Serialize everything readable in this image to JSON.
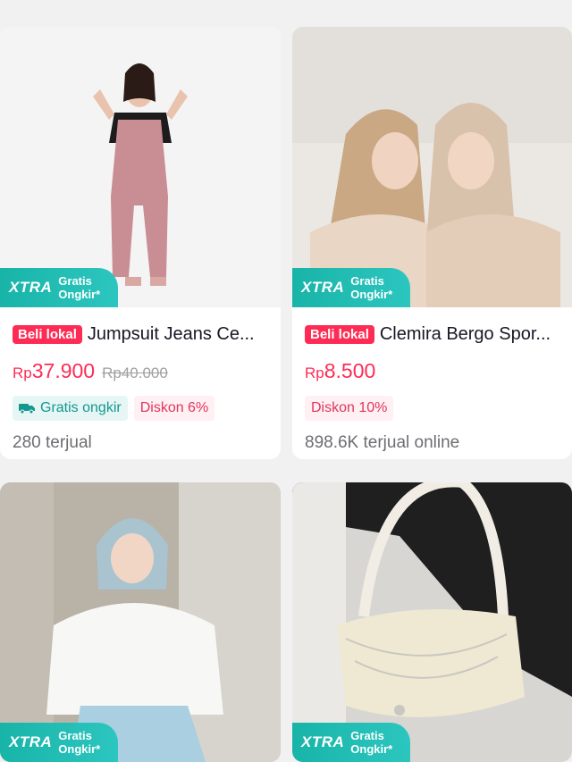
{
  "products": [
    {
      "badge_main": "XTRA",
      "badge_sub1": "Gratis",
      "badge_sub2": "Ongkir*",
      "lokal": "Beli lokal",
      "title": "Jumpsuit Jeans Ce...",
      "currency": "Rp",
      "price": "37.900",
      "old_price": "Rp40.000",
      "tag_ship": "Gratis ongkir",
      "tag_discount": "Diskon 6%",
      "sold": "280 terjual"
    },
    {
      "badge_main": "XTRA",
      "badge_sub1": "Gratis",
      "badge_sub2": "Ongkir*",
      "lokal": "Beli lokal",
      "title": "Clemira Bergo Spor...",
      "currency": "Rp",
      "price": "8.500",
      "tag_discount": "Diskon 10%",
      "sold": "898.6K terjual online"
    },
    {
      "badge_main": "XTRA",
      "badge_sub1": "Gratis",
      "badge_sub2": "Ongkir*"
    },
    {
      "badge_main": "XTRA",
      "badge_sub1": "Gratis",
      "badge_sub2": "Ongkir*"
    }
  ],
  "colors": {
    "accent": "#fe2c55",
    "xtra_teal": "#19b4a8",
    "page_bg": "#f1f1f1"
  }
}
